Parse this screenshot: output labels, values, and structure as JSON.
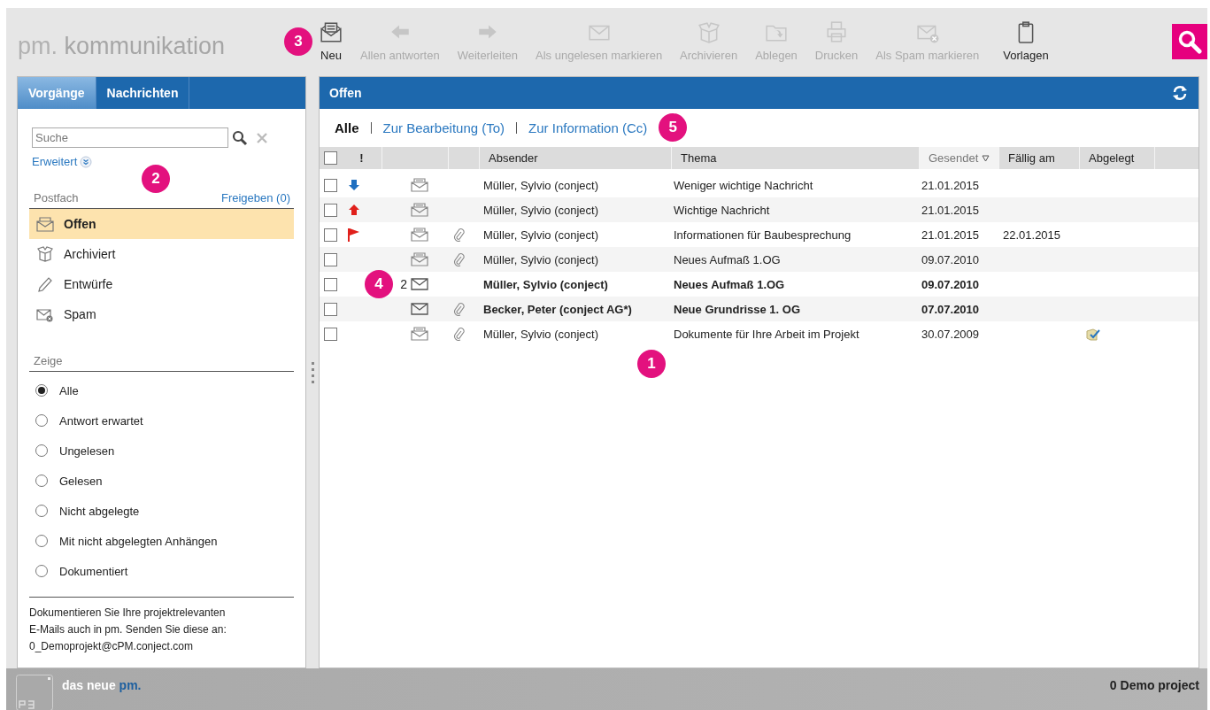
{
  "app": {
    "brand_prefix": "pm.",
    "brand_name": "kommunikation"
  },
  "toolbar": [
    {
      "label": "Neu",
      "kind": "new",
      "enabled": true,
      "callout": "3"
    },
    {
      "label": "Allen antworten",
      "kind": "reply-all",
      "enabled": false
    },
    {
      "label": "Weiterleiten",
      "kind": "forward",
      "enabled": false
    },
    {
      "label": "Als ungelesen markieren",
      "kind": "unread",
      "enabled": false
    },
    {
      "label": "Archivieren",
      "kind": "archive",
      "enabled": false
    },
    {
      "label": "Ablegen",
      "kind": "file",
      "enabled": false
    },
    {
      "label": "Drucken",
      "kind": "print",
      "enabled": false
    },
    {
      "label": "Als Spam markieren",
      "kind": "spam",
      "enabled": false
    },
    {
      "label": "Vorlagen",
      "kind": "templates",
      "enabled": true
    }
  ],
  "sidebar": {
    "tabs": [
      {
        "label": "Vorgänge",
        "selected": true
      },
      {
        "label": "Nachrichten",
        "selected": false
      }
    ],
    "search": {
      "placeholder": "Suche"
    },
    "advanced_link": "Erweitert",
    "callout": "2",
    "mailbox": {
      "title": "Postfach",
      "share_link": "Freigeben (0)",
      "folders": [
        {
          "label": "Offen",
          "kind": "open",
          "selected": true
        },
        {
          "label": "Archiviert",
          "kind": "archive",
          "selected": false
        },
        {
          "label": "Entwürfe",
          "kind": "drafts",
          "selected": false
        },
        {
          "label": "Spam",
          "kind": "spam",
          "selected": false
        }
      ]
    },
    "show": {
      "title": "Zeige",
      "options": [
        {
          "label": "Alle",
          "selected": true
        },
        {
          "label": "Antwort erwartet",
          "selected": false
        },
        {
          "label": "Ungelesen",
          "selected": false
        },
        {
          "label": "Gelesen",
          "selected": false
        },
        {
          "label": "Nicht abgelegte",
          "selected": false
        },
        {
          "label": "Mit nicht abgelegten Anhängen",
          "selected": false
        },
        {
          "label": "Dokumentiert",
          "selected": false
        }
      ]
    },
    "info": {
      "lines": [
        "Dokumentieren Sie Ihre projektrelevanten",
        "E-Mails auch in pm. Senden Sie diese an:",
        "0_Demoprojekt@cPM.conject.com"
      ]
    }
  },
  "main": {
    "title": "Offen",
    "filters": [
      {
        "label": "Alle",
        "selected": true
      },
      {
        "label": "Zur Bearbeitung (To)",
        "selected": false
      },
      {
        "label": "Zur Information (Cc)",
        "selected": false
      }
    ],
    "filters_callout": "5",
    "table": {
      "select_all_checked": false,
      "columns": [
        {
          "label": "!",
          "sorted": false
        },
        {
          "label": "Absender",
          "sorted": false
        },
        {
          "label": "Thema",
          "sorted": false
        },
        {
          "label": "Gesendet",
          "sorted": true
        },
        {
          "label": "Fällig am",
          "sorted": false
        },
        {
          "label": "Abgelegt",
          "sorted": false
        }
      ],
      "rows": [
        {
          "checked": false,
          "kind": "low",
          "read": true,
          "attachment": false,
          "sender": "Müller, Sylvio (conject)",
          "subject": "Weniger wichtige Nachricht",
          "sent": "21.01.2015",
          "filed": false
        },
        {
          "checked": false,
          "kind": "high",
          "read": true,
          "attachment": false,
          "sender": "Müller, Sylvio (conject)",
          "subject": "Wichtige Nachricht",
          "sent": "21.01.2015",
          "filed": false
        },
        {
          "checked": false,
          "kind": "flag",
          "read": true,
          "attachment": true,
          "sender": "Müller, Sylvio (conject)",
          "subject": "Informationen für Baubesprechung",
          "sent": "21.01.2015",
          "due": "22.01.2015",
          "filed": false
        },
        {
          "checked": false,
          "kind": "plain",
          "read": true,
          "attachment": true,
          "sender": "Müller, Sylvio (conject)",
          "subject": "Neues Aufmaß 1.OG",
          "sent": "09.07.2010",
          "filed": false
        },
        {
          "checked": false,
          "kind": "plain",
          "thread_count": "2",
          "read": false,
          "attachment": false,
          "sender": "Müller, Sylvio (conject)",
          "subject": "Neues Aufmaß 1.OG",
          "sent": "09.07.2010",
          "filed": false,
          "callout": "4"
        },
        {
          "checked": false,
          "kind": "plain",
          "read": false,
          "attachment": true,
          "sender": "Becker, Peter (conject AG*)",
          "subject": "Neue Grundrisse 1. OG",
          "sent": "07.07.2010",
          "filed": false
        },
        {
          "checked": false,
          "kind": "plain",
          "read": true,
          "attachment": true,
          "sender": "Müller, Sylvio (conject)",
          "subject": "Dokumente für Ihre Arbeit im Projekt",
          "sent": "30.07.2009",
          "filed": true
        }
      ],
      "callout": "1"
    }
  },
  "footer": {
    "tagline_prefix": "das neue",
    "tagline_brand": "pm.",
    "project": "0 Demo project"
  }
}
